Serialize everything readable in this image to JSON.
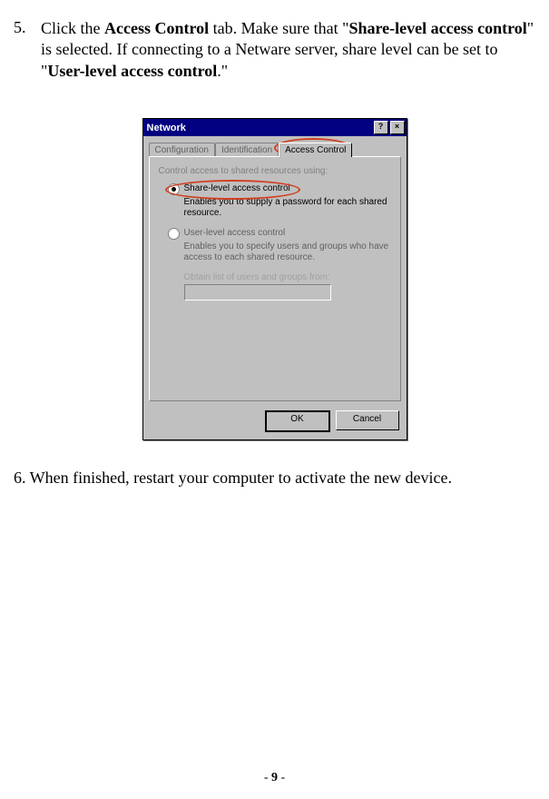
{
  "step5": {
    "number": "5.",
    "text_parts": {
      "p1": "Click the ",
      "b1": "Access Control",
      "p2": " tab.   Make sure that \"",
      "b2": "Share-level access control",
      "p3": "\" is selected.   If connecting to a Netware server, share level can be set to \"",
      "b3": "User-level access control",
      "p4": ".\""
    }
  },
  "dialog": {
    "title": "Network",
    "help_btn": "?",
    "close_btn": "×",
    "tabs": {
      "configuration": "Configuration",
      "identification": "Identification",
      "access_control": "Access Control"
    },
    "group_label": "Control access to shared resources using:",
    "radio1": {
      "label": "Share-level access control",
      "desc": "Enables you to supply a password for each shared resource."
    },
    "radio2": {
      "label": "User-level access control",
      "desc": "Enables you to specify users and groups who have access to each shared resource."
    },
    "obtain_label": "Obtain list of users and groups from:",
    "ok": "OK",
    "cancel": "Cancel"
  },
  "step6": "6. When finished, restart your computer to activate the new device.",
  "page_number": "9"
}
